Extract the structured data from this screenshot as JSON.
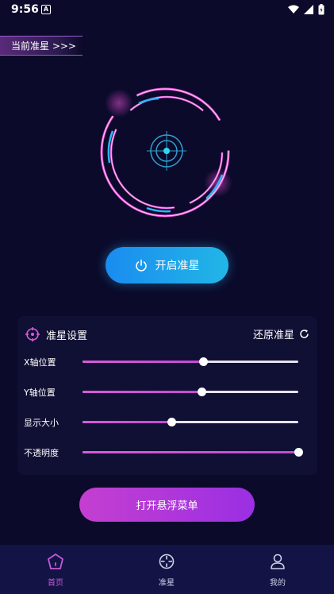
{
  "status_bar": {
    "time": "9:56",
    "notification_icon": "A"
  },
  "crosshair_tag": {
    "label": "当前准星 >>>"
  },
  "power_button": {
    "label": "开启准星",
    "icon": "power-icon"
  },
  "settings": {
    "title": "准星设置",
    "reset_label": "还原准星",
    "sliders": [
      {
        "label": "X轴位置",
        "value": 0.56
      },
      {
        "label": "Y轴位置",
        "value": 0.55
      },
      {
        "label": "显示大小",
        "value": 0.41
      },
      {
        "label": "不透明度",
        "value": 1.0
      }
    ]
  },
  "float_menu_button": {
    "label": "打开悬浮菜单"
  },
  "tab_bar": {
    "tabs": [
      {
        "label": "首页",
        "icon": "home-icon",
        "active": true
      },
      {
        "label": "准星",
        "icon": "crosshair-icon",
        "active": false
      },
      {
        "label": "我的",
        "icon": "profile-icon",
        "active": false
      }
    ]
  },
  "colors": {
    "background": "#0b0a2a",
    "accent_pink": "#e44dd4",
    "accent_blue": "#22b6e6",
    "tab_active": "#c15bd6",
    "tab_inactive": "#cfd0e8"
  }
}
